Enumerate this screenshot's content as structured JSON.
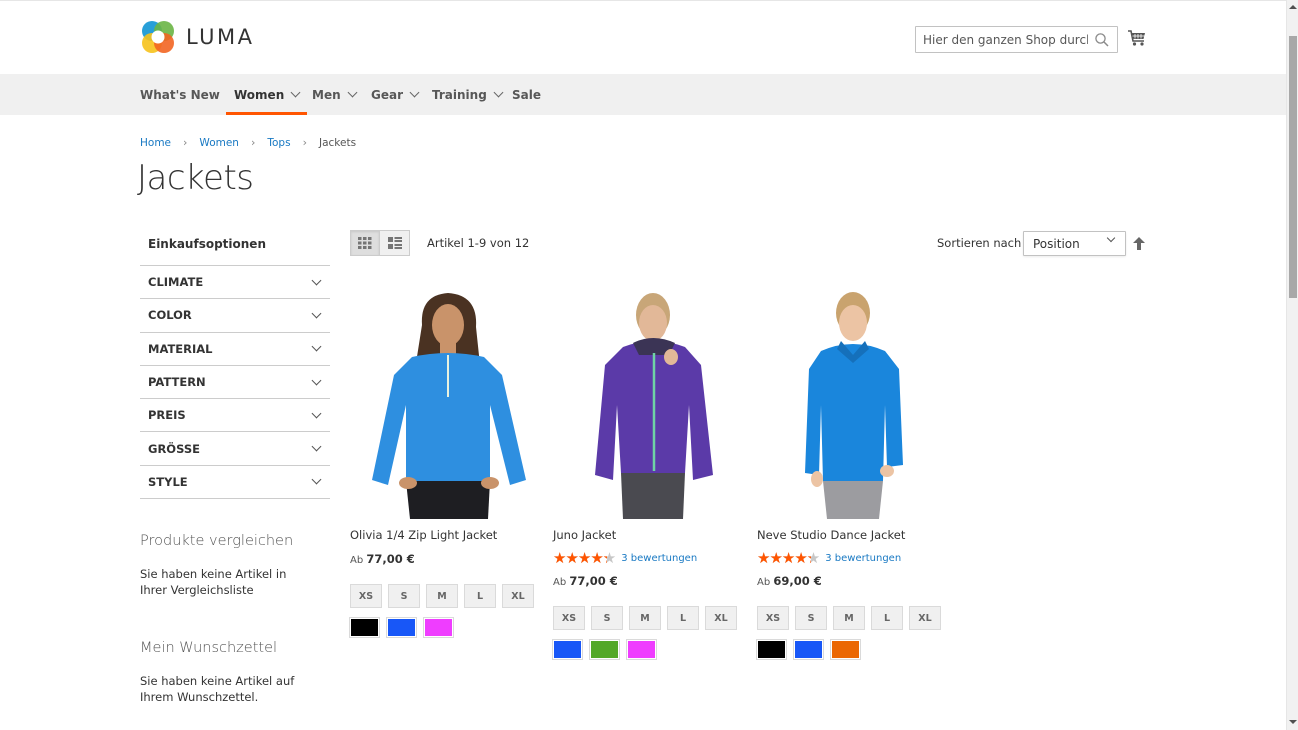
{
  "header": {
    "logo_text": "LUMA",
    "search_placeholder": "Hier den ganzen Shop durchsuchen...",
    "search_icon": "search-icon",
    "cart_icon": "shopping-cart-icon"
  },
  "nav": {
    "items": [
      {
        "label": "What's New",
        "has_dropdown": false,
        "active": false
      },
      {
        "label": "Women",
        "has_dropdown": true,
        "active": true
      },
      {
        "label": "Men",
        "has_dropdown": true,
        "active": false
      },
      {
        "label": "Gear",
        "has_dropdown": true,
        "active": false
      },
      {
        "label": "Training",
        "has_dropdown": true,
        "active": false
      },
      {
        "label": "Sale",
        "has_dropdown": false,
        "active": false
      }
    ],
    "accent_color": "#ff5501"
  },
  "breadcrumb": {
    "items": [
      "Home",
      "Women",
      "Tops"
    ],
    "current": "Jackets",
    "separator": "›"
  },
  "page_title": "Jackets",
  "sidebar": {
    "filter_title": "Einkaufsoptionen",
    "filters": [
      "CLIMATE",
      "COLOR",
      "MATERIAL",
      "PATTERN",
      "PREIS",
      "GRÖSSE",
      "STYLE"
    ],
    "compare": {
      "title": "Produkte vergleichen",
      "text": "Sie haben keine Artikel in Ihrer Vergleichsliste"
    },
    "wishlist": {
      "title": "Mein Wunschzettel",
      "text": "Sie haben keine Artikel auf Ihrem Wunschzettel."
    }
  },
  "toolbar": {
    "view_modes": [
      {
        "name": "grid",
        "icon": "grid-icon",
        "active": true
      },
      {
        "name": "list",
        "icon": "list-icon",
        "active": false
      }
    ],
    "amount": "Artikel 1-9 von 12",
    "sort_label": "Sortieren nach",
    "sort_value": "Position",
    "sort_direction_icon": "arrow-up-icon"
  },
  "products": [
    {
      "name": "Olivia 1/4 Zip Light Jacket",
      "price_prefix": "Ab",
      "price": "77,00 €",
      "rating_percent": null,
      "reviews": null,
      "sizes": [
        "XS",
        "S",
        "M",
        "L",
        "XL"
      ],
      "colors": [
        "#000000",
        "#1857f7",
        "#ef3dff"
      ],
      "jacket_color": "#2e8fe0",
      "pants_color": "#1e1e22",
      "hair_color": "#4a3222"
    },
    {
      "name": "Juno Jacket",
      "price_prefix": "Ab",
      "price": "77,00 €",
      "rating_percent": 87,
      "reviews": "3 bewertungen",
      "sizes": [
        "XS",
        "S",
        "M",
        "L",
        "XL"
      ],
      "colors": [
        "#1857f7",
        "#53a828",
        "#ef3dff"
      ],
      "jacket_color": "#5b3aa8",
      "pants_color": "#4a4a50",
      "hair_color": "#c8a678"
    },
    {
      "name": "Neve Studio Dance Jacket",
      "price_prefix": "Ab",
      "price": "69,00 €",
      "rating_percent": 87,
      "reviews": "3 bewertungen",
      "sizes": [
        "XS",
        "S",
        "M",
        "L",
        "XL"
      ],
      "colors": [
        "#000000",
        "#1857f7",
        "#eb6703"
      ],
      "jacket_color": "#1a86dc",
      "pants_color": "#9c9ca0",
      "hair_color": "#c9a36e"
    }
  ]
}
